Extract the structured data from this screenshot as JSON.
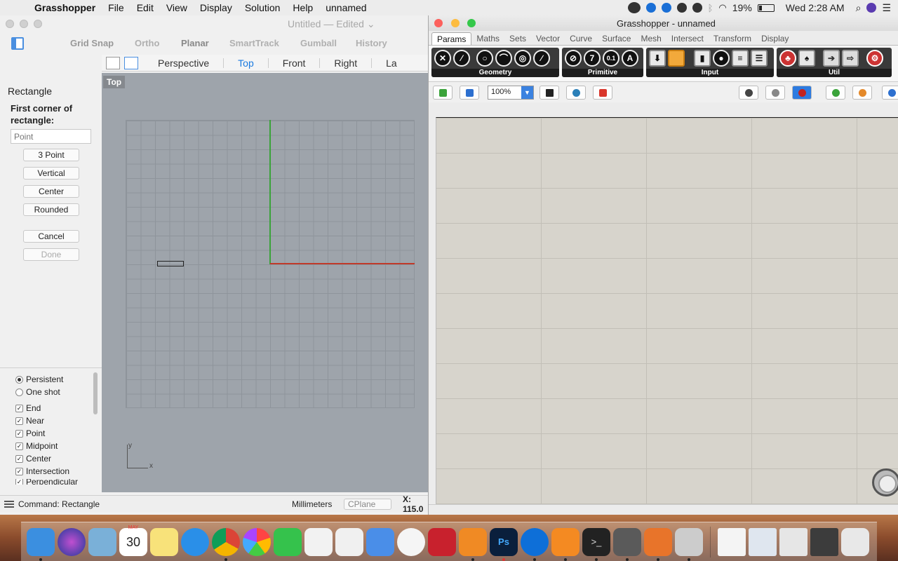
{
  "menubar": {
    "app_name": "Grasshopper",
    "items": [
      "File",
      "Edit",
      "View",
      "Display",
      "Solution",
      "Help",
      "unnamed"
    ],
    "battery": "19%",
    "clock": "Wed 2:28 AM"
  },
  "rhino": {
    "title": "Untitled — Edited ⌄",
    "toolbar": {
      "grid_snap": "Grid Snap",
      "ortho": "Ortho",
      "planar": "Planar",
      "smarttrack": "SmartTrack",
      "gumball": "Gumball",
      "history": "History"
    },
    "view_tabs": [
      "Perspective",
      "Top",
      "Front",
      "Right"
    ],
    "view_tab_active": "Top",
    "view_tab_cut": "La",
    "command": {
      "title": "Rectangle",
      "prompt": "First corner of rectangle:",
      "input_placeholder": "Point",
      "options": [
        "3 Point",
        "Vertical",
        "Center",
        "Rounded"
      ],
      "cancel": "Cancel",
      "done": "Done"
    },
    "osnap": {
      "modes": [
        {
          "label": "Persistent",
          "selected": true
        },
        {
          "label": "One shot",
          "selected": false
        }
      ],
      "snaps": [
        {
          "label": "End",
          "checked": true
        },
        {
          "label": "Near",
          "checked": true
        },
        {
          "label": "Point",
          "checked": true
        },
        {
          "label": "Midpoint",
          "checked": true
        },
        {
          "label": "Center",
          "checked": true
        },
        {
          "label": "Intersection",
          "checked": true
        },
        {
          "label": "Perpendicular",
          "checked": true
        }
      ]
    },
    "viewport_label": "Top",
    "axis_y": "y",
    "axis_x": "x",
    "status": {
      "command": "Command: Rectangle",
      "units": "Millimeters",
      "cplane": "CPlane",
      "x": "X: 115.0"
    }
  },
  "grasshopper": {
    "title": "Grasshopper - unnamed",
    "tabs": [
      "Params",
      "Maths",
      "Sets",
      "Vector",
      "Curve",
      "Surface",
      "Mesh",
      "Intersect",
      "Transform",
      "Display"
    ],
    "tab_active": "Params",
    "ribbon_groups": [
      "Geometry",
      "Primitive",
      "Input",
      "Util"
    ],
    "primitive_glyphs": [
      "7",
      "0.1",
      "A"
    ],
    "zoom": "100%"
  },
  "dock": {
    "calendar_month": "MAY",
    "calendar_day": "30"
  }
}
